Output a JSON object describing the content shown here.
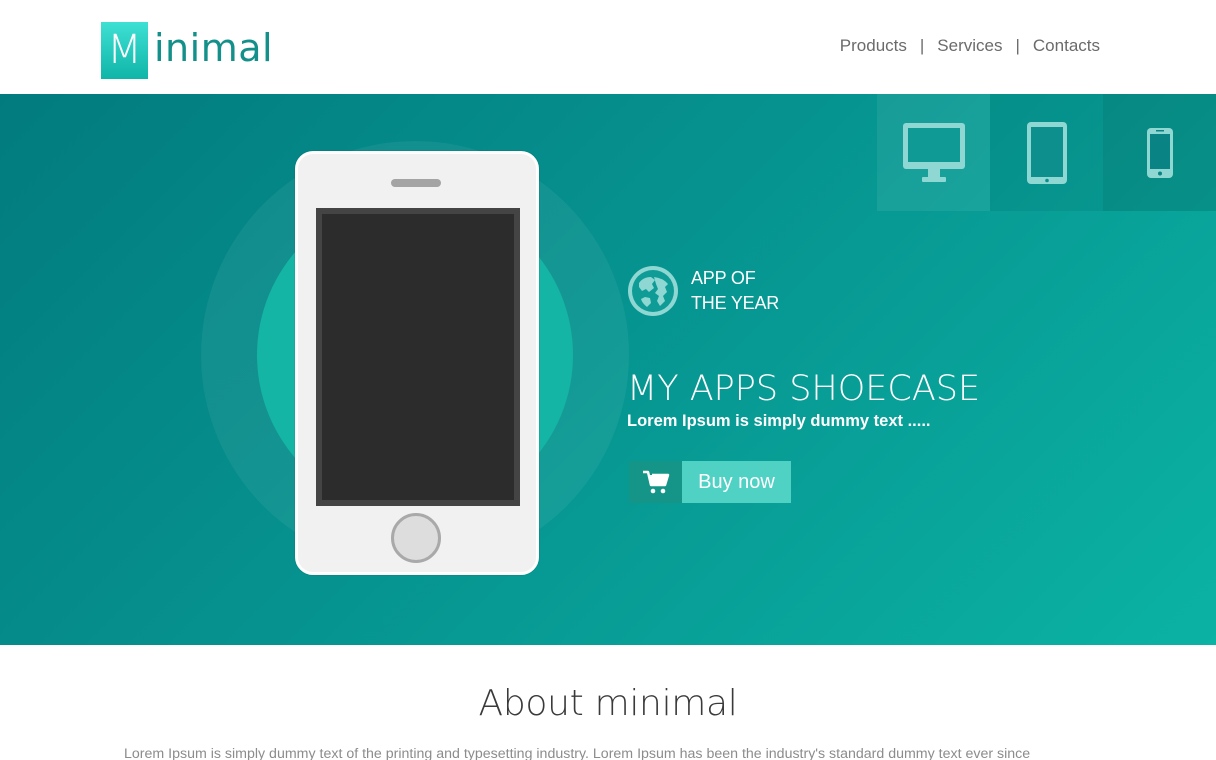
{
  "logo": {
    "letter": "M",
    "rest": "inimal"
  },
  "nav": {
    "items": [
      {
        "label": "Products"
      },
      {
        "label": "Services"
      },
      {
        "label": "Contacts"
      }
    ],
    "separator": "|"
  },
  "hero": {
    "device_tabs": [
      {
        "icon": "desktop-icon"
      },
      {
        "icon": "tablet-icon"
      },
      {
        "icon": "smartphone-icon"
      }
    ],
    "award": {
      "line1": "APP OF",
      "line2": "THE YEAR",
      "icon": "globe-icon"
    },
    "title": "MY APPS SHOECASE",
    "subtitle": "Lorem Ipsum is simply dummy text .....",
    "buy_button": {
      "label": "Buy now",
      "icon": "cart-icon"
    }
  },
  "about": {
    "title": "About minimal",
    "text": "Lorem Ipsum is simply dummy text of the printing and typesetting industry. Lorem Ipsum has been the industry's standard dummy text ever since"
  },
  "colors": {
    "brand_teal": "#14908a",
    "hero_dark": "#027b7e",
    "hero_light": "#0bb3a4",
    "button_light": "#4fd1c4",
    "button_dark": "#149588"
  }
}
